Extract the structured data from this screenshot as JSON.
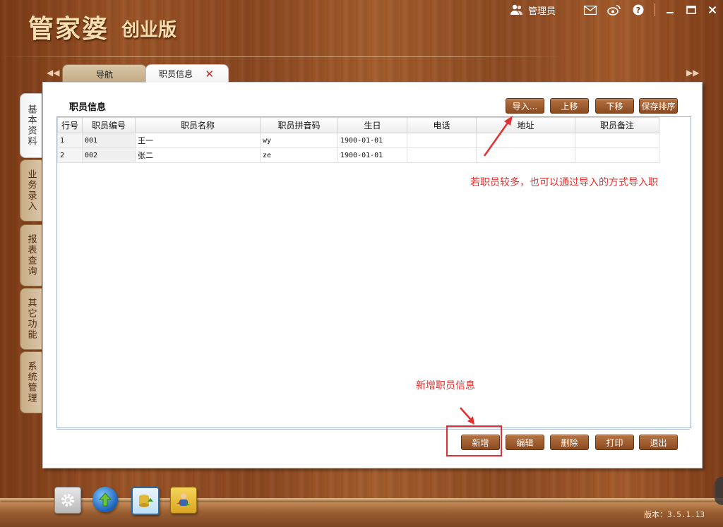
{
  "app": {
    "logo_main": "管家婆",
    "logo_sub": "创业版"
  },
  "topbar": {
    "user_label": "管理员"
  },
  "tabs": [
    {
      "label": "导航"
    },
    {
      "label": "职员信息"
    }
  ],
  "side_tabs": [
    {
      "label": "基本资料"
    },
    {
      "label": "业务录入"
    },
    {
      "label": "报表查询"
    },
    {
      "label": "其它功能"
    },
    {
      "label": "系统管理"
    }
  ],
  "panel": {
    "title": "职员信息"
  },
  "toolbar": {
    "import": "导入...",
    "move_up": "上移",
    "move_down": "下移",
    "save_order": "保存排序"
  },
  "table": {
    "headers": [
      "行号",
      "职员编号",
      "职员名称",
      "职员拼音码",
      "生日",
      "电话",
      "地址",
      "职员备注"
    ],
    "rows": [
      [
        "1",
        "001",
        "王一",
        "wy",
        "1900-01-01",
        "",
        "",
        ""
      ],
      [
        "2",
        "002",
        "张二",
        "ze",
        "1900-01-01",
        "",
        "",
        ""
      ]
    ]
  },
  "actions": {
    "add": "新增",
    "edit": "编辑",
    "delete": "删除",
    "print": "打印",
    "exit": "退出"
  },
  "annotations": {
    "import_tip": "若职员较多，也可以通过导入的方式导入职",
    "add_tip": "新增职员信息",
    "color": "#e22f2f"
  },
  "dock": {
    "icons": [
      "settings-gear-icon",
      "globe-upload-icon",
      "database-export-icon",
      "user-transfer-icon"
    ]
  },
  "footer": {
    "version": "版本：3.5.1.13"
  }
}
